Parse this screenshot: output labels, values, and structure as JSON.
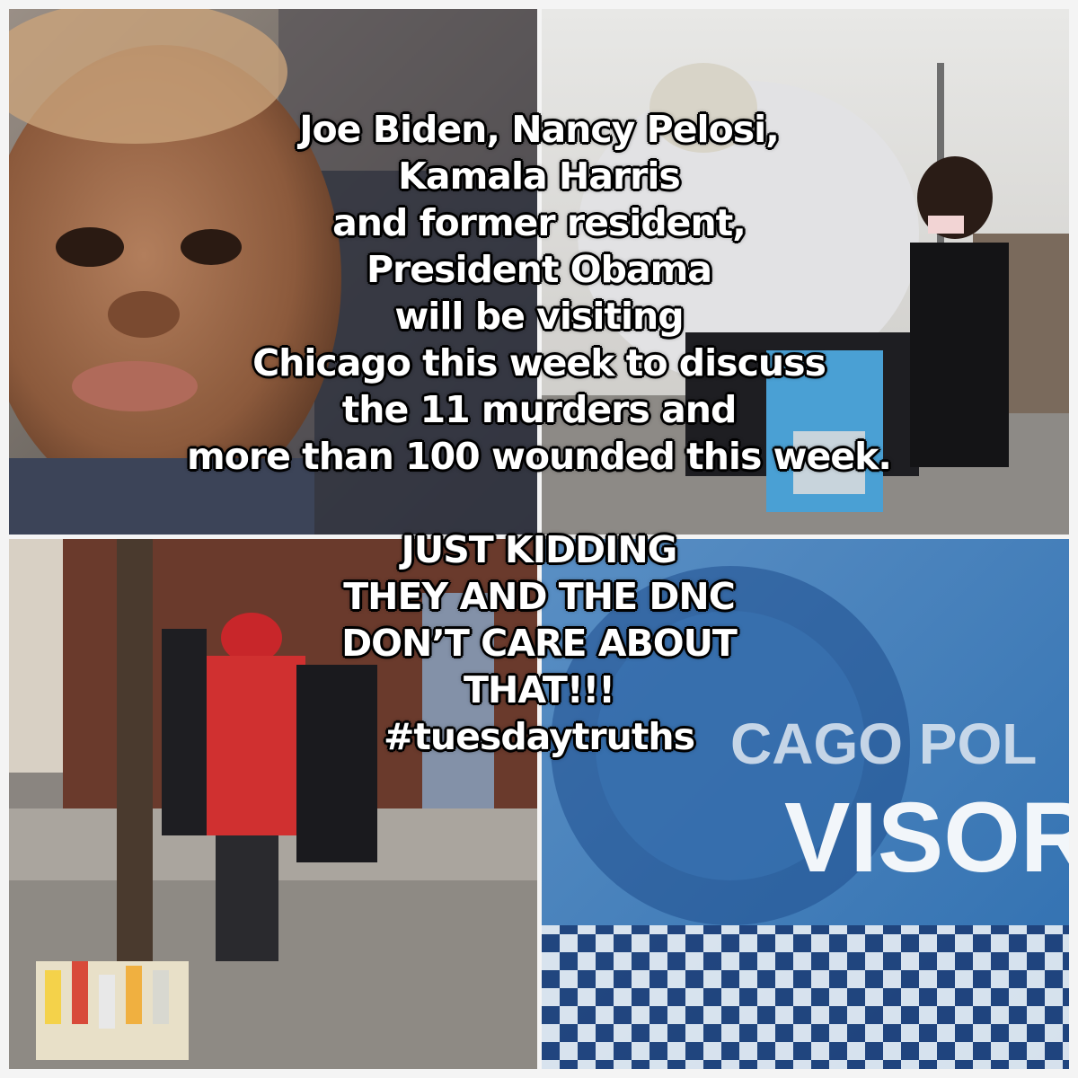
{
  "overlay": {
    "lines": [
      "Joe Biden, Nancy Pelosi,",
      "Kamala Harris",
      "and former resident,",
      "President Obama",
      "will be visiting",
      "Chicago this week to discuss",
      "the 11 murders and",
      "more than 100 wounded this week."
    ],
    "punchline": [
      "JUST KIDDING",
      "THEY AND THE DNC",
      "DON’T CARE ABOUT",
      "THAT!!!",
      "#tuesdaytruths"
    ]
  },
  "photos": {
    "bottom_right_sign_text_1": "CAGO POL",
    "bottom_right_sign_text_2": "VISOR"
  },
  "colors": {
    "background": "#f4f4f4",
    "text": "#ffffff",
    "text_outline": "#000000",
    "police_blue": "#2f6fb0"
  }
}
